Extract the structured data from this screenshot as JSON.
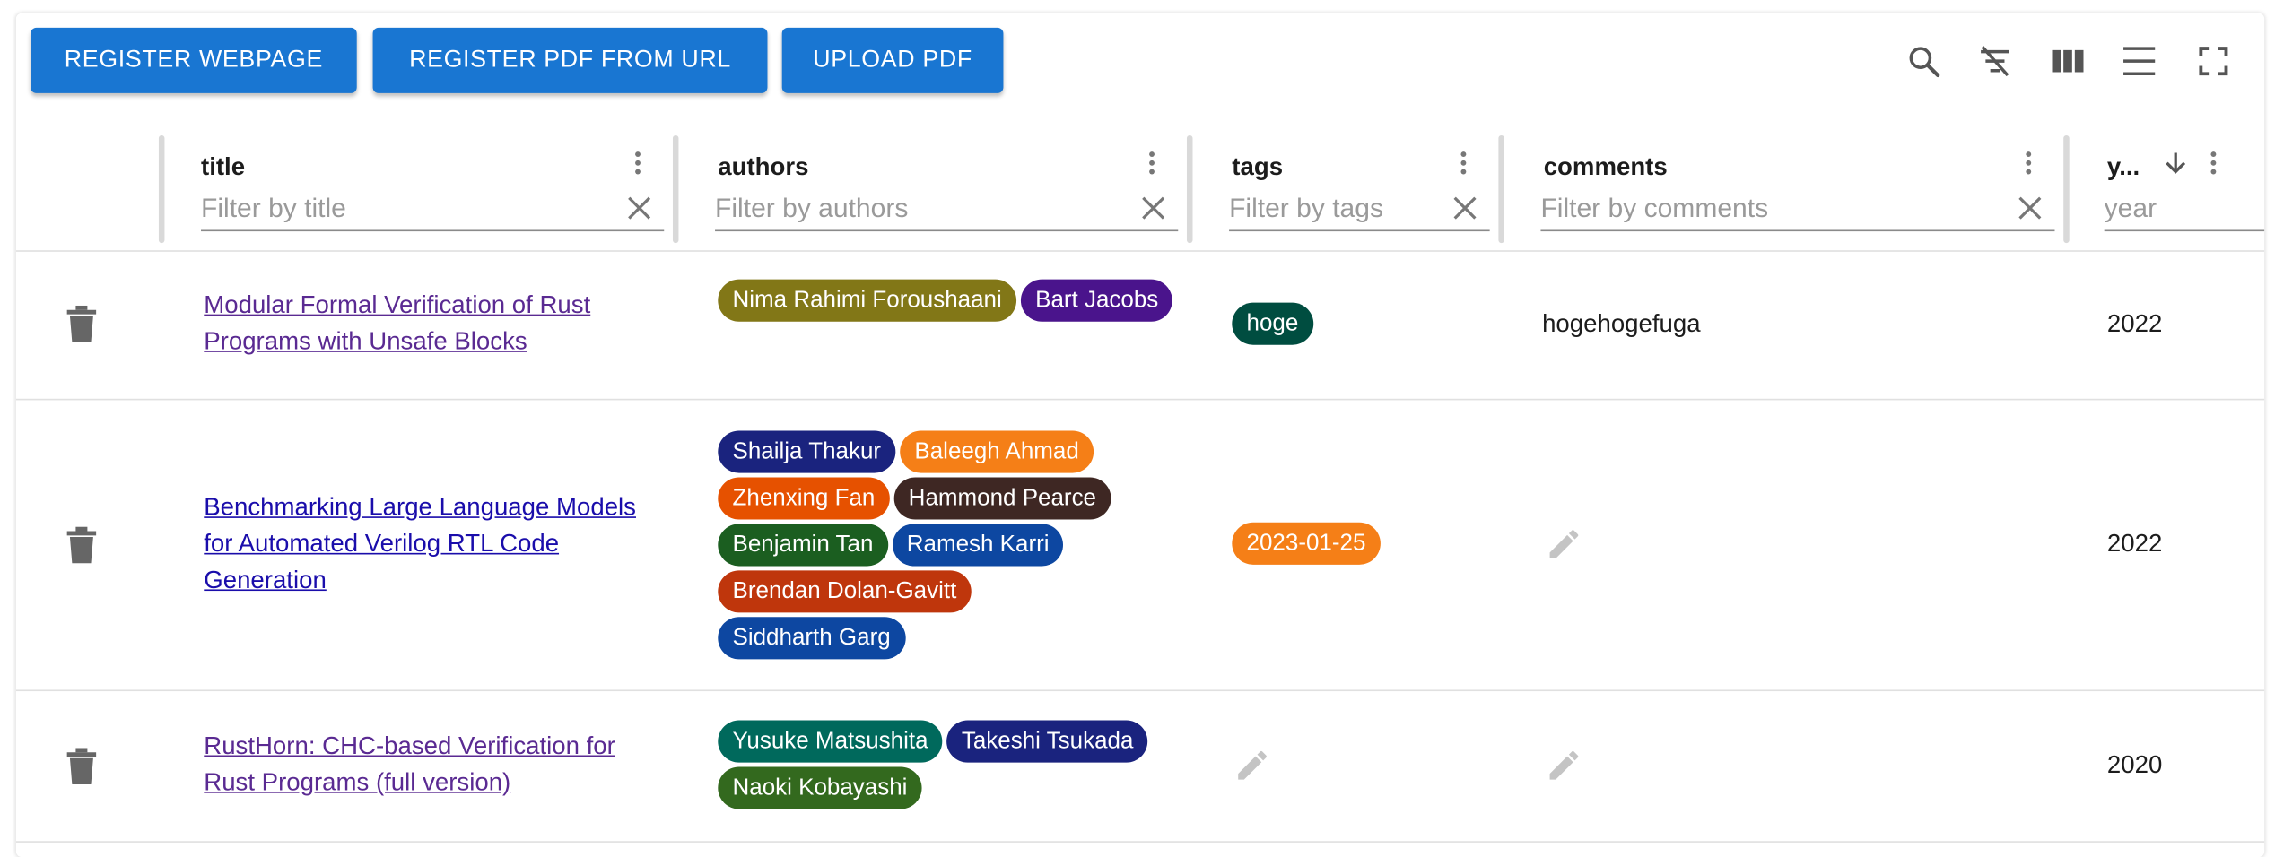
{
  "toolbar": {
    "register_webpage": "REGISTER WEBPAGE",
    "register_pdf_url": "REGISTER PDF FROM URL",
    "upload_pdf": "UPLOAD PDF",
    "icons": [
      "search-icon",
      "filter-off-icon",
      "columns-icon",
      "density-icon",
      "fullscreen-icon"
    ]
  },
  "columns": {
    "title": {
      "label": "title",
      "placeholder": "Filter by title"
    },
    "authors": {
      "label": "authors",
      "placeholder": "Filter by authors"
    },
    "tags": {
      "label": "tags",
      "placeholder": "Filter by tags"
    },
    "comments": {
      "label": "comments",
      "placeholder": "Filter by comments"
    },
    "year": {
      "label": "y...",
      "placeholder": "year"
    }
  },
  "rows": [
    {
      "title": "Modular Formal Verification of Rust Programs with Unsafe Blocks",
      "authors": [
        {
          "name": "Nima Rahimi Foroushaani",
          "color": "#827717"
        },
        {
          "name": "Bart Jacobs",
          "color": "#4a148c"
        }
      ],
      "tags": [
        {
          "name": "hoge",
          "color": "#004d40"
        }
      ],
      "comment": "hogehogefuga",
      "year": "2022"
    },
    {
      "title": "Benchmarking Large Language Models for Automated Verilog RTL Code Generation",
      "authors": [
        {
          "name": "Shailja Thakur",
          "color": "#1a237e"
        },
        {
          "name": "Baleegh Ahmad",
          "color": "#f57f17"
        },
        {
          "name": "Zhenxing Fan",
          "color": "#e65100"
        },
        {
          "name": "Hammond Pearce",
          "color": "#3e2723"
        },
        {
          "name": "Benjamin Tan",
          "color": "#1b5e20"
        },
        {
          "name": "Ramesh Karri",
          "color": "#0d47a1"
        },
        {
          "name": "Brendan Dolan-Gavitt",
          "color": "#bf360c"
        },
        {
          "name": "Siddharth Garg",
          "color": "#0d47a1"
        }
      ],
      "tags": [
        {
          "name": "2023-01-25",
          "color": "#f57f17"
        }
      ],
      "comment": "",
      "year": "2022"
    },
    {
      "title": "RustHorn: CHC-based Verification for Rust Programs (full version)",
      "authors": [
        {
          "name": "Yusuke Matsushita",
          "color": "#00695c"
        },
        {
          "name": "Takeshi Tsukada",
          "color": "#1a237e"
        },
        {
          "name": "Naoki Kobayashi",
          "color": "#33691e"
        }
      ],
      "tags": [],
      "comment": "",
      "year": "2020"
    }
  ]
}
